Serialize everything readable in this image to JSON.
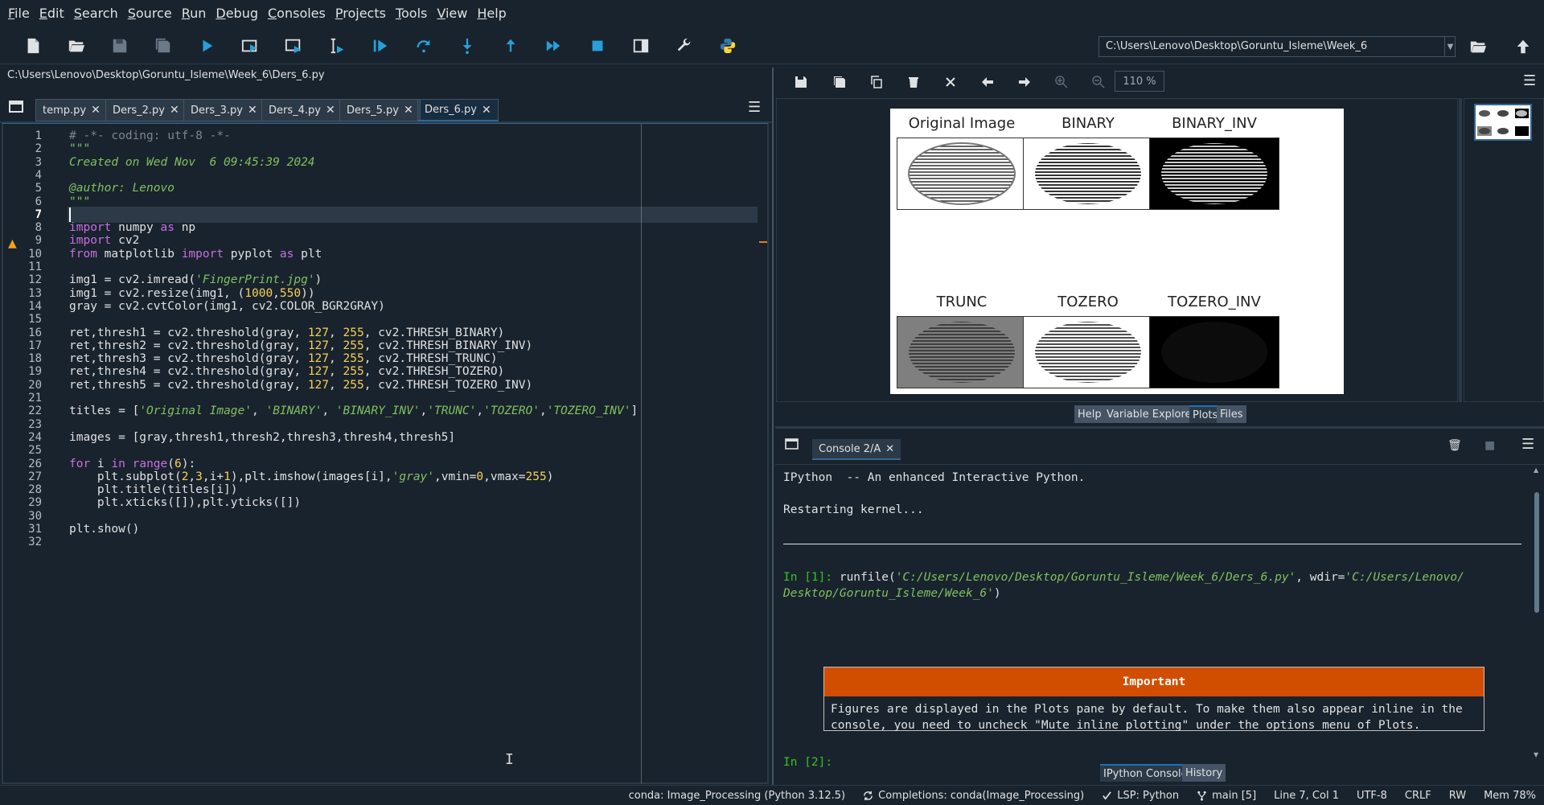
{
  "menubar": [
    "File",
    "Edit",
    "Search",
    "Source",
    "Run",
    "Debug",
    "Consoles",
    "Projects",
    "Tools",
    "View",
    "Help"
  ],
  "toolbar": {
    "buttons": [
      "new-file",
      "open-file",
      "save-file",
      "save-all",
      "run-file",
      "run-cell",
      "run-cell-advance",
      "run-selection",
      "debug-file",
      "debug-step",
      "debug-step-into",
      "debug-step-return",
      "debug-continue",
      "debug-stop",
      "maximize-pane",
      "preferences",
      "python-path"
    ],
    "working_dir": "C:\\Users\\Lenovo\\Desktop\\Goruntu_Isleme\\Week_6"
  },
  "editor": {
    "file_path": "C:\\Users\\Lenovo\\Desktop\\Goruntu_Isleme\\Week_6\\Ders_6.py",
    "tabs": [
      "temp.py",
      "Ders_2.py",
      "Ders_3.py",
      "Ders_4.py",
      "Ders_5.py",
      "Ders_6.py"
    ],
    "active_tab": "Ders_6.py",
    "current_line": 7,
    "lines": [
      "# -*- coding: utf-8 -*-",
      "\"\"\"",
      "Created on Wed Nov  6 09:45:39 2024",
      "",
      "@author: Lenovo",
      "\"\"\"",
      "",
      "import numpy as np",
      "import cv2",
      "from matplotlib import pyplot as plt",
      "",
      "img1 = cv2.imread('FingerPrint.jpg')",
      "img1 = cv2.resize(img1, (1000,550))",
      "gray = cv2.cvtColor(img1, cv2.COLOR_BGR2GRAY)",
      "",
      "ret,thresh1 = cv2.threshold(gray, 127, 255, cv2.THRESH_BINARY)",
      "ret,thresh2 = cv2.threshold(gray, 127, 255, cv2.THRESH_BINARY_INV)",
      "ret,thresh3 = cv2.threshold(gray, 127, 255, cv2.THRESH_TRUNC)",
      "ret,thresh4 = cv2.threshold(gray, 127, 255, cv2.THRESH_TOZERO)",
      "ret,thresh5 = cv2.threshold(gray, 127, 255, cv2.THRESH_TOZERO_INV)",
      "",
      "titles = ['Original Image', 'BINARY', 'BINARY_INV','TRUNC','TOZERO','TOZERO_INV']",
      "",
      "images = [gray,thresh1,thresh2,thresh3,thresh4,thresh5]",
      "",
      "for i in range(6):",
      "    plt.subplot(2,3,i+1),plt.imshow(images[i],'gray',vmin=0,vmax=255)",
      "    plt.title(titles[i])",
      "    plt.xticks([]),plt.yticks([])",
      "",
      "plt.show()",
      ""
    ]
  },
  "plots": {
    "zoom": "110 %",
    "subplot_titles": [
      "Original Image",
      "BINARY",
      "BINARY_INV",
      "TRUNC",
      "TOZERO",
      "TOZERO_INV"
    ],
    "pane_tabs": [
      "Help",
      "Variable Explorer",
      "Plots",
      "Files"
    ],
    "active_pane_tab": "Plots"
  },
  "console": {
    "tab": "Console 2/A",
    "banner": "IPython  -- An enhanced Interactive Python.",
    "restart": "Restarting kernel...",
    "in1_prompt": "In [1]:",
    "in1_fn": " runfile(",
    "in1_arg1": "'C:/Users/Lenovo/Desktop/Goruntu_Isleme/Week_6/Ders_6.py'",
    "in1_mid": ", wdir=",
    "in1_arg2a": "'C:/Users/Lenovo/",
    "in1_arg2b": "Desktop/Goruntu_Isleme/Week_6'",
    "in1_end": ")",
    "important_title": "Important",
    "important_line1": "Figures are displayed in the Plots pane by default. To make them also appear inline in the",
    "important_line2": "console, you need to uncheck \"Mute inline plotting\" under the options menu of Plots.",
    "in2_prompt": "In [2]:",
    "bottom_tabs": [
      "IPython Console",
      "History"
    ],
    "active_bottom_tab": "IPython Console"
  },
  "status": {
    "conda": "conda: Image_Processing (Python 3.12.5)",
    "completions": "Completions: conda(Image_Processing)",
    "lsp": "LSP: Python",
    "git": "main [5]",
    "position": "Line 7, Col 1",
    "encoding": "UTF-8",
    "eol": "CRLF",
    "rw": "RW",
    "mem": "Mem 78%"
  },
  "colors": {
    "background": "#19232d",
    "accent": "#346792",
    "important": "#d14e00",
    "prompt": "#34c424"
  }
}
